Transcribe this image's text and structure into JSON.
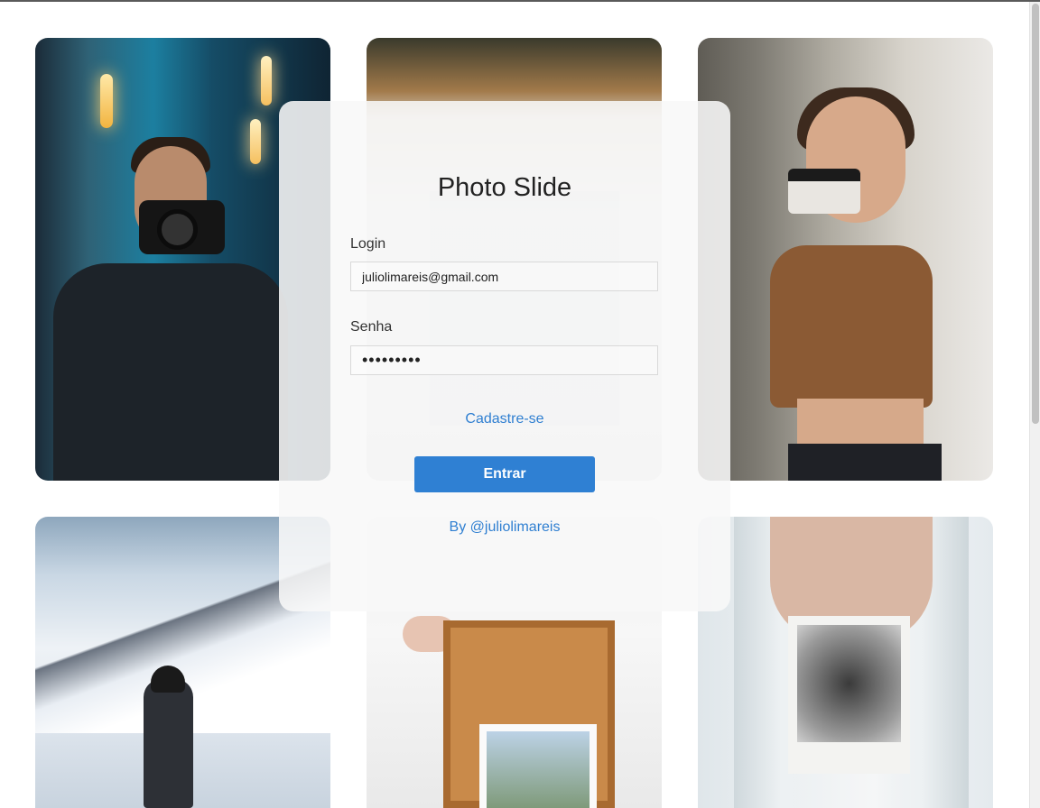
{
  "app": {
    "title": "Photo Slide"
  },
  "form": {
    "login_label": "Login",
    "login_value": "juliolimareis@gmail.com",
    "password_label": "Senha",
    "password_value": "•••••••••",
    "signup_link": "Cadastre-se",
    "submit_label": "Entrar",
    "credit": "By @juliolimareis"
  },
  "colors": {
    "accent": "#2f80d3",
    "link": "#2f7fd1",
    "card_bg": "#f8f8f8"
  }
}
